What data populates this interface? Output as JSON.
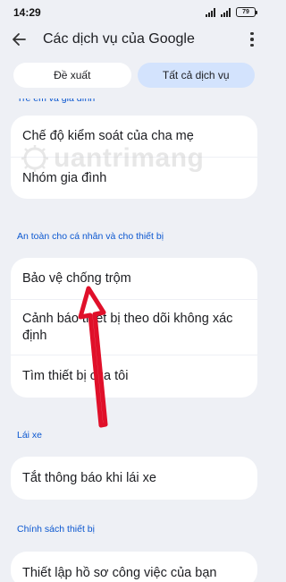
{
  "status_bar": {
    "time": "14:29",
    "battery": "79"
  },
  "app_bar": {
    "title": "Các dịch vụ của Google"
  },
  "tabs": [
    {
      "label": "Đề xuất"
    },
    {
      "label": "Tất cả dịch vụ"
    }
  ],
  "sections": [
    {
      "header": "Trẻ em và gia đình",
      "items": [
        "Chế độ kiểm soát của cha mẹ",
        "Nhóm gia đình"
      ]
    },
    {
      "header": "An toàn cho cá nhân và cho thiết bị",
      "items": [
        "Bảo vệ chống trộm",
        "Cảnh báo thiết bị theo dõi không xác định",
        "Tìm thiết bị của tôi"
      ]
    },
    {
      "header": "Lái xe",
      "items": [
        "Tắt thông báo khi lái xe"
      ]
    },
    {
      "header": "Chính sách thiết bị",
      "items": [
        "Thiết lập hồ sơ công việc của bạn"
      ]
    }
  ],
  "watermark": {
    "text": "uantrimang"
  },
  "colors": {
    "background": "#eef0f5",
    "accent": "#0b57d0",
    "active_tab": "#d3e3fd",
    "arrow": "#e0102a"
  }
}
